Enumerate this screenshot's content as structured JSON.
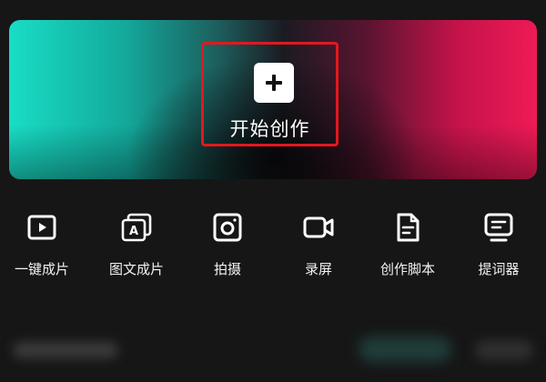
{
  "hero": {
    "create_label": "开始创作",
    "create_icon": "plus-icon",
    "highlight_color": "#e0191f"
  },
  "tools": [
    {
      "label": "一键成片",
      "icon": "play-video-icon"
    },
    {
      "label": "图文成片",
      "icon": "text-image-icon"
    },
    {
      "label": "拍摄",
      "icon": "camera-icon"
    },
    {
      "label": "录屏",
      "icon": "screen-record-icon"
    },
    {
      "label": "创作脚本",
      "icon": "script-document-icon"
    },
    {
      "label": "提词器",
      "icon": "teleprompter-icon"
    }
  ],
  "colors": {
    "accent_cyan": "#19ddc6",
    "accent_pink": "#ef1a56",
    "background": "#161616"
  }
}
